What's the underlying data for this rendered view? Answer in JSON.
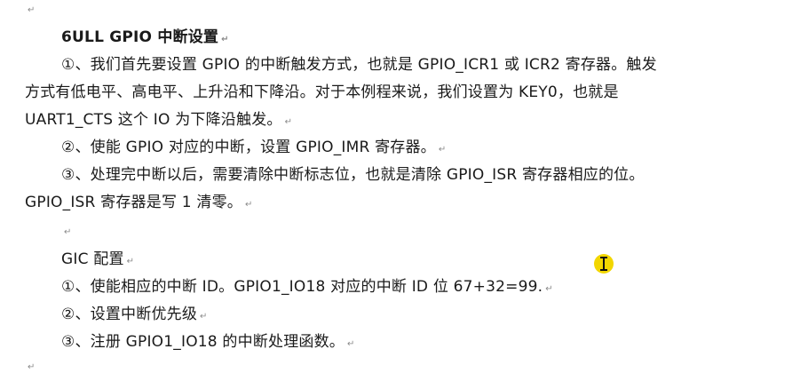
{
  "paragraph_mark": "↵",
  "lines": [
    {
      "id": "l01",
      "text": "6ULL GPIO 中断设置"
    },
    {
      "id": "l02",
      "text": "①、我们首先要设置 GPIO 的中断触发方式，也就是 GPIO_ICR1 或 ICR2 寄存器。触发"
    },
    {
      "id": "l03",
      "text": "方式有低电平、高电平、上升沿和下降沿。对于本例程来说，我们设置为  KEY0，也就是"
    },
    {
      "id": "l04",
      "text": "UART1_CTS 这个 IO 为下降沿触发。"
    },
    {
      "id": "l05",
      "text": "②、使能 GPIO 对应的中断，设置 GPIO_IMR 寄存器。"
    },
    {
      "id": "l06",
      "text": "③、处理完中断以后，需要清除中断标志位，也就是清除 GPIO_ISR 寄存器相应的位。"
    },
    {
      "id": "l07",
      "text": "GPIO_ISR 寄存器是写 1 清零。"
    },
    {
      "id": "l08",
      "text": "GIC 配置"
    },
    {
      "id": "l09",
      "text": "①、使能相应的中断 ID。GPIO1_IO18 对应的中断 ID 位 67+32=99."
    },
    {
      "id": "l10",
      "text": "②、设置中断优先级"
    },
    {
      "id": "l11",
      "text": "③、注册 GPIO1_IO18 的中断处理函数。"
    }
  ],
  "colors": {
    "text": "#1a1a1a",
    "paragraph_mark": "#8a8a8a",
    "cursor_highlight": "#f2d600"
  }
}
